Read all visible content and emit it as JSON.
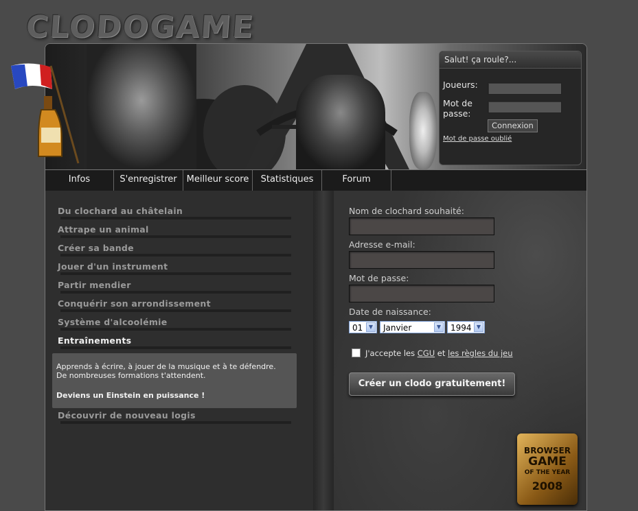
{
  "logo": {
    "text": "CLODOGAME"
  },
  "login": {
    "header": "Salut! ça roule?...",
    "player_label": "Joueurs:",
    "password_label_1": "Mot de",
    "password_label_2": "passe:",
    "connect_button": "Connexion",
    "forgot_link": "Mot de passe oublié"
  },
  "nav": {
    "items": [
      "Infos",
      "S'enregistrer",
      "Meilleur score",
      "Statistiques",
      "Forum"
    ]
  },
  "menu": {
    "items": [
      "Du clochard au châtelain",
      "Attrape un animal",
      "Créer sa bande",
      "Jouer d'un instrument",
      "Partir mendier",
      "Conquérir son arrondissement",
      "Système d'alcoolémie",
      "Entraînements",
      "Découvrir de nouveau logis"
    ],
    "active_index": 7,
    "description_1": "Apprends à écrire, à jouer de la musique et à te défendre.",
    "description_2": "De nombreuses formations t'attendent.",
    "description_bold": "Deviens un Einstein en puissance !"
  },
  "form": {
    "username_label": "Nom de clochard souhaité:",
    "email_label": "Adresse e-mail:",
    "password_label": "Mot de passe:",
    "birthdate_label": "Date de naissance:",
    "day": "01",
    "month": "Janvier",
    "year": "1994",
    "accept_prefix": "J'accepte les",
    "cgu_link": "CGU",
    "and_text": "et",
    "rules_link": "les règles du jeu",
    "submit": "Créer un clodo gratuitement!"
  },
  "badge": {
    "line1": "BROWSER",
    "line2": "GAME",
    "line3": "OF THE YEAR",
    "year": "2008"
  }
}
